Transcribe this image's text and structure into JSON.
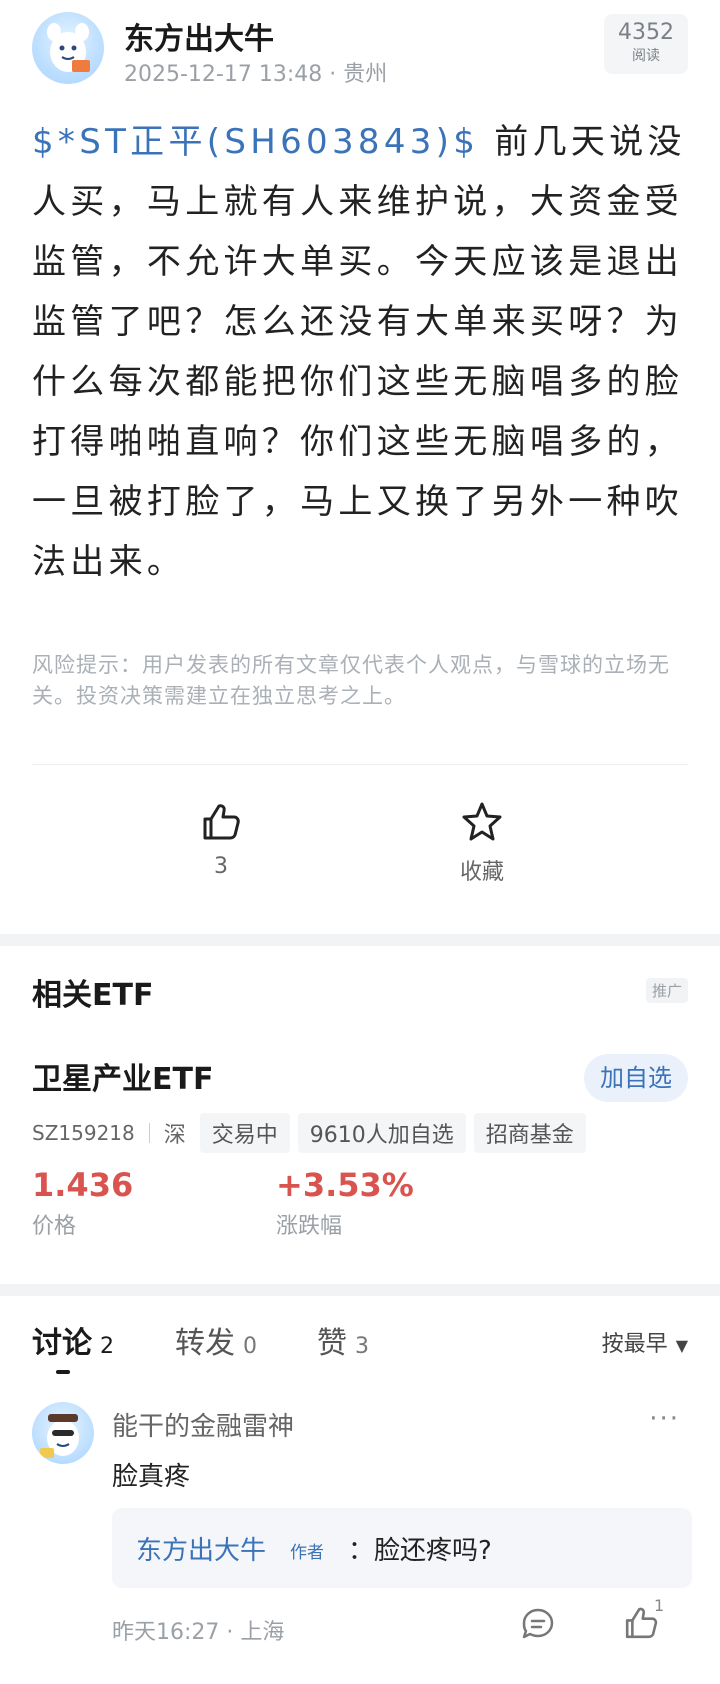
{
  "post": {
    "author": "东方出大牛",
    "meta": "2025-12-17 13:48 · 贵州",
    "read_count": "4352",
    "read_label": "阅读",
    "stock_tag": "$*ST正平(SH603843)$",
    "content": " 前几天说没人买，马上就有人来维护说，大资金受监管，不允许大单买。今天应该是退出监管了吧？怎么还没有大单来买呀？为什么每次都能把你们这些无脑唱多的脸打得啪啪直响？你们这些无脑唱多的，一旦被打脸了，马上又换了另外一种吹法出来。",
    "risk_notice": "风险提示：用户发表的所有文章仅代表个人观点，与雪球的立场无关。投资决策需建立在独立思考之上。",
    "like_count": "3",
    "favorite_label": "收藏"
  },
  "etf": {
    "section_title": "相关ETF",
    "ad_label": "推广",
    "name": "卫星产业ETF",
    "add_button": "加自选",
    "code": "SZ159218",
    "exchange": "深",
    "chips": [
      "交易中",
      "9610人加自选",
      "招商基金"
    ],
    "price": "1.436",
    "price_label": "价格",
    "change": "+3.53%",
    "change_label": "涨跌幅"
  },
  "tabs": [
    {
      "label": "讨论",
      "count": "2"
    },
    {
      "label": "转发",
      "count": "0"
    },
    {
      "label": "赞",
      "count": "3"
    }
  ],
  "sort_label": "按最早",
  "comment": {
    "user": "能干的金融雷神",
    "more": "···",
    "text": "脸真疼",
    "reply_author": "东方出大牛",
    "author_tag": "作者",
    "reply_text": "：脸还疼吗?",
    "time": "昨天16:27 · 上海",
    "like_count": "1"
  },
  "colors": {
    "link": "#3b73b9",
    "up": "#d9534f"
  }
}
